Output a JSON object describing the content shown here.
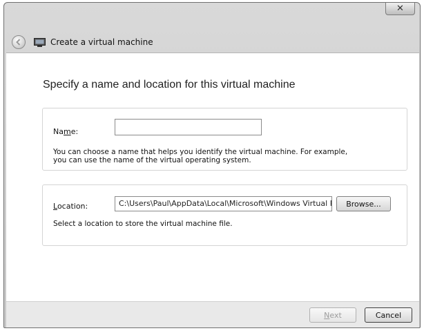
{
  "window": {
    "title": "Create a virtual machine",
    "close_glyph": "✕"
  },
  "main": {
    "heading": "Specify a name and location for this virtual machine",
    "name_group": {
      "label_prefix": "Na",
      "label_mnemonic": "m",
      "label_suffix": "e:",
      "value": "",
      "help_line1": "You can choose a name that helps you identify the virtual machine. For example,",
      "help_line2": "you can use the name of the virtual operating system."
    },
    "location_group": {
      "label_mnemonic": "L",
      "label_suffix": "ocation:",
      "value": "C:\\Users\\Paul\\AppData\\Local\\Microsoft\\Windows Virtual PC",
      "browse_label": "Browse...",
      "help": "Select a location to store the virtual machine file."
    }
  },
  "footer": {
    "next_mnemonic": "N",
    "next_suffix": "ext",
    "cancel_label": "Cancel"
  },
  "icons": {
    "back": "back-arrow-icon",
    "app": "virtual-pc-icon",
    "close": "close-icon"
  }
}
